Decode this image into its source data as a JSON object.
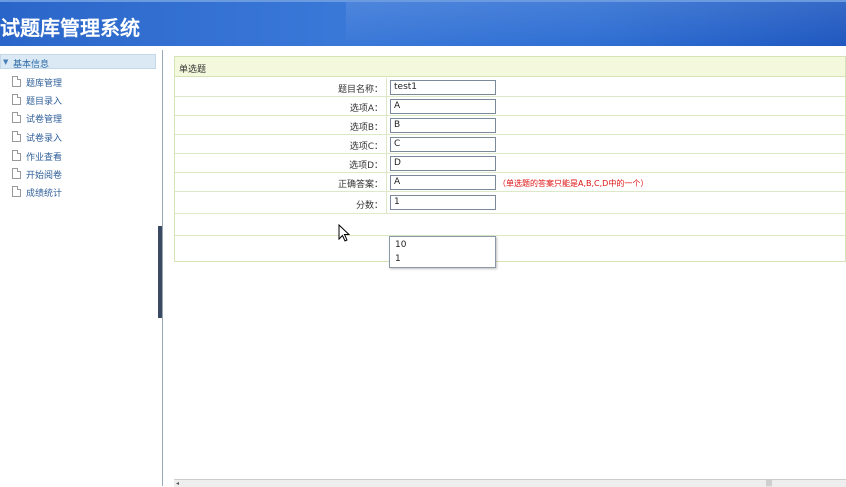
{
  "header": {
    "title": "试题库管理系统"
  },
  "sidebar": {
    "section_label": "基本信息",
    "items": [
      {
        "label": "题库管理"
      },
      {
        "label": "题目录入"
      },
      {
        "label": "试卷管理"
      },
      {
        "label": "试卷录入"
      },
      {
        "label": "作业查看"
      },
      {
        "label": "开始阅卷"
      },
      {
        "label": "成绩统计"
      }
    ]
  },
  "form": {
    "panel_title": "单选题",
    "fields": [
      {
        "label": "题目名称：",
        "value": "test1"
      },
      {
        "label": "选项A：",
        "value": "A"
      },
      {
        "label": "选项B：",
        "value": "B"
      },
      {
        "label": "选项C：",
        "value": "C"
      },
      {
        "label": "选项D：",
        "value": "D"
      },
      {
        "label": "正确答案：",
        "value": "A",
        "hint": "（单选题的答案只能是A,B,C,D中的一个）"
      },
      {
        "label": "分数：",
        "value": "1"
      }
    ],
    "autocomplete": [
      "10",
      "1"
    ]
  },
  "colors": {
    "header_blue": "#2f6fd3",
    "hint_red": "#dd1111",
    "panel_head": "#f4f8dc"
  }
}
